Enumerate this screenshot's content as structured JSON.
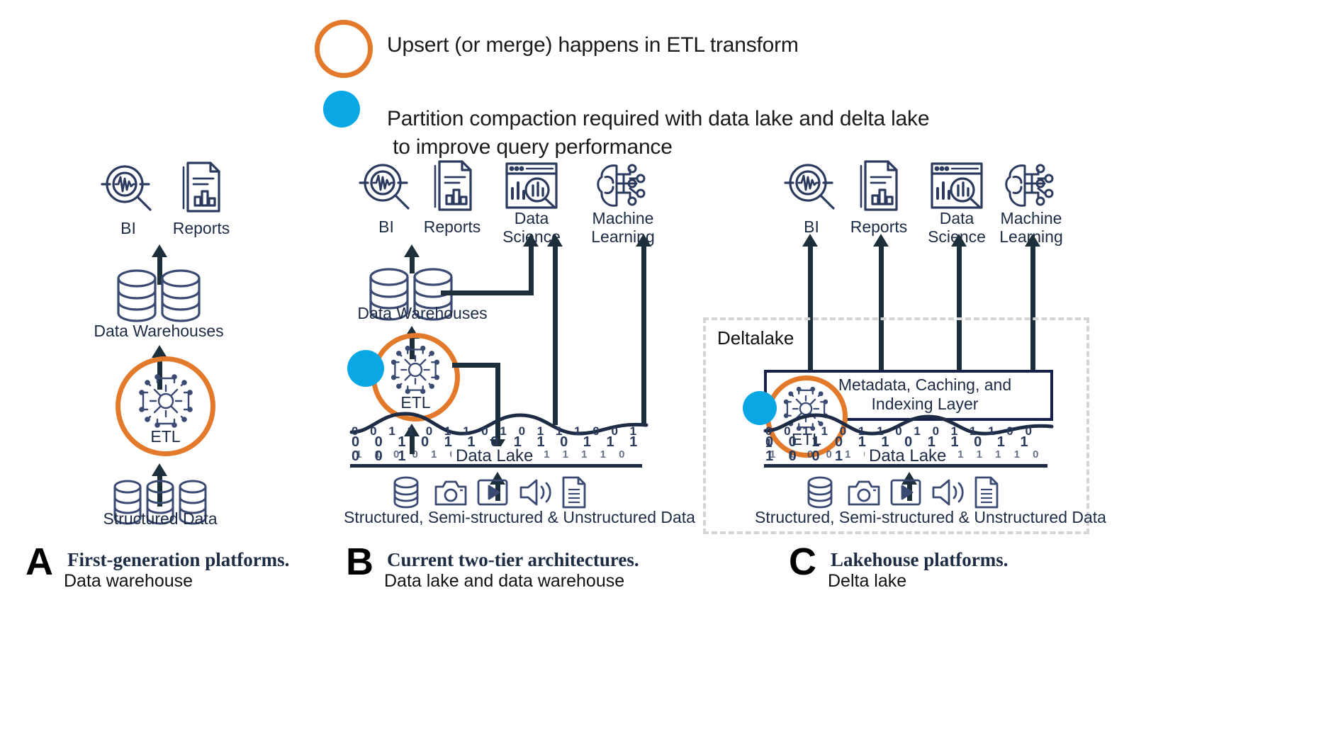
{
  "legend": {
    "items": [
      {
        "marker": "orange-circle-outline",
        "marker_color": "#E3792B",
        "text": "Upsert (or merge) happens in ETL transform"
      },
      {
        "marker": "blue-circle-filled",
        "marker_color": "#0AA7E5",
        "text": "Partition compaction required with data lake and delta lake\n to improve query performance"
      }
    ]
  },
  "colors": {
    "orange": "#E3792B",
    "blue": "#0AA7E5",
    "navy": "#1d2b44",
    "dark": "#1d2f3a",
    "dashed_gray": "#d4d4d4"
  },
  "panels": [
    {
      "id": "A",
      "letter": "A",
      "caption_title": "First-generation platforms.",
      "caption_sub": "Data warehouse",
      "consumers": [
        {
          "icon": "bi-magnifier-waveform-icon",
          "label": "BI"
        },
        {
          "icon": "reports-document-chart-icon",
          "label": "Reports"
        }
      ],
      "warehouse_label": "Data Warehouses",
      "etl_label": "ETL",
      "source_label": "Structured Data"
    },
    {
      "id": "B",
      "letter": "B",
      "caption_title": "Current two-tier architectures.",
      "caption_sub": "Data lake and data warehouse",
      "consumers": [
        {
          "icon": "bi-magnifier-waveform-icon",
          "label": "BI"
        },
        {
          "icon": "reports-document-chart-icon",
          "label": "Reports"
        },
        {
          "icon": "data-science-window-chart-icon",
          "label": "Data\nScience"
        },
        {
          "icon": "machine-learning-brain-circuit-icon",
          "label": "Machine\nLearning"
        }
      ],
      "warehouse_label": "Data Warehouses",
      "etl_label": "ETL",
      "lake_label": "Data Lake",
      "source_label": "Structured, Semi-structured & Unstructured Data",
      "source_icons": [
        "database-cylinder-icon",
        "camera-icon",
        "video-play-icon",
        "audio-speaker-icon",
        "document-icon"
      ]
    },
    {
      "id": "C",
      "letter": "C",
      "caption_title": "Lakehouse platforms.",
      "caption_sub": "Delta lake",
      "consumers": [
        {
          "icon": "bi-magnifier-waveform-icon",
          "label": "BI"
        },
        {
          "icon": "reports-document-chart-icon",
          "label": "Reports"
        },
        {
          "icon": "data-science-window-chart-icon",
          "label": "Data\nScience"
        },
        {
          "icon": "machine-learning-brain-circuit-icon",
          "label": "Machine\nLearning"
        }
      ],
      "delta_label": "Deltalake",
      "metadata_layer_label": "Metadata, Caching, and\nIndexing Layer",
      "etl_label": "ETL",
      "lake_label": "Data Lake",
      "source_label": "Structured, Semi-structured & Unstructured Data",
      "source_icons": [
        "database-cylinder-icon",
        "camera-icon",
        "video-play-icon",
        "audio-speaker-icon",
        "document-icon"
      ]
    }
  ]
}
